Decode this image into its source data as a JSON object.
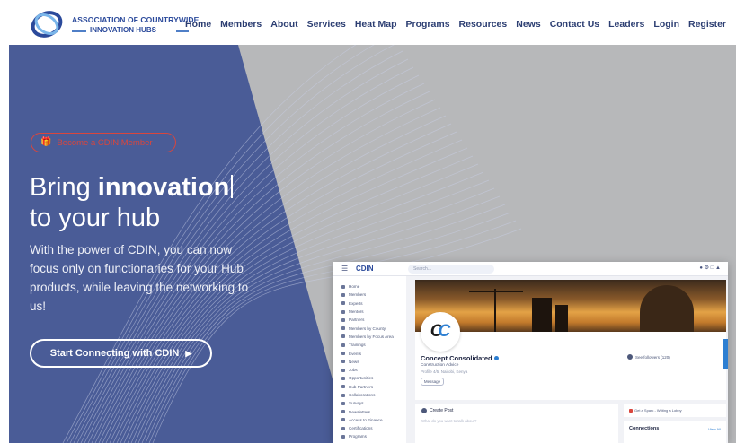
{
  "header": {
    "logo": {
      "line1": "ASSOCIATION OF COUNTRYWIDE",
      "line2": "INNOVATION HUBS"
    },
    "nav": [
      {
        "label": "Home"
      },
      {
        "label": "Members"
      },
      {
        "label": "About"
      },
      {
        "label": "Services"
      },
      {
        "label": "Heat Map"
      },
      {
        "label": "Programs"
      },
      {
        "label": "Resources"
      },
      {
        "label": "News"
      },
      {
        "label": "Contact Us"
      },
      {
        "label": "Leaders"
      },
      {
        "label": "Login"
      },
      {
        "label": "Register"
      }
    ]
  },
  "hero": {
    "badge": "Become a CDIN Member",
    "headline_pre": "Bring ",
    "headline_bold": "innovation",
    "headline_line2": "to your hub",
    "lead": "With the power of CDIN, you can now focus only on functionaries for your Hub products, while leaving the networking to us!",
    "cta_label": "Start Connecting with CDIN",
    "colors": {
      "panel": "#4a5c97",
      "background": "#b7b8ba",
      "badge": "#d9463d"
    }
  },
  "app_mock": {
    "brand": "CDIN",
    "search_placeholder": "Search...",
    "sidebar": [
      "Home",
      "Members",
      "Experts",
      "Mentors",
      "Partners",
      "Members by County",
      "Members by Focus Area",
      "Trainings",
      "Events",
      "News",
      "Jobs",
      "Opportunities",
      "Hub Partners",
      "Collaborations",
      "Surveys",
      "Newsletters",
      "Access to Finance",
      "Certifications",
      "Programs"
    ],
    "company": "Concept Consolidated",
    "role": "Construction Advice",
    "location": "Profile 4/5, Nairobi, Kenya",
    "message_button": "Message",
    "followers": "See followers (120)",
    "create_post": "Create Post",
    "post_placeholder": "What do you want to talk about?",
    "notice": "Get a Spark - Writing a Lobby",
    "connections": "Connections",
    "view_all": "View All"
  }
}
